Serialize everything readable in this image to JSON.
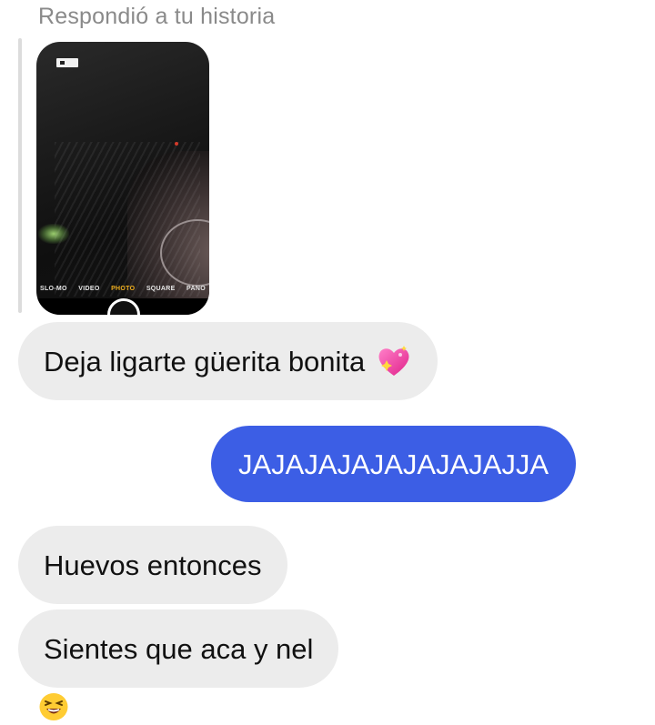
{
  "reply_header": {
    "label": "Respondió a tu historia"
  },
  "story_preview": {
    "camera_modes": [
      "SLO-MO",
      "VIDEO",
      "PHOTO",
      "SQUARE",
      "PANO"
    ],
    "active_mode": "PHOTO"
  },
  "messages": [
    {
      "direction": "received",
      "text": "Deja ligarte güerita bonita",
      "emoji": "sparkling-heart-icon"
    },
    {
      "direction": "sent",
      "text": "JAJAJAJAJAJAJAJAJJA"
    },
    {
      "direction": "received",
      "text": "Huevos entonces"
    },
    {
      "direction": "received",
      "text": "Sientes que aca y nel"
    },
    {
      "direction": "received",
      "emoji": "laughing-face-icon"
    }
  ],
  "colors": {
    "sent_bubble": "#3c5ee5",
    "received_bubble": "#ececec",
    "reply_label": "#8a8a8a"
  }
}
